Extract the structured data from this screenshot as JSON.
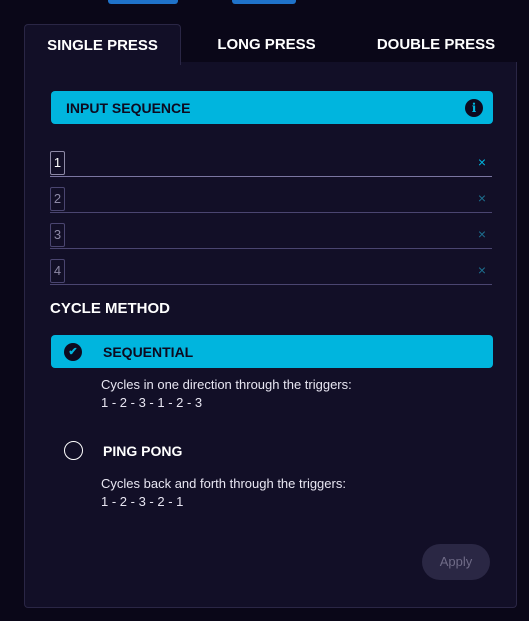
{
  "tabs": [
    {
      "label": "SINGLE PRESS",
      "active": true
    },
    {
      "label": "LONG PRESS",
      "active": false
    },
    {
      "label": "DOUBLE PRESS",
      "active": false
    }
  ],
  "input_sequence": {
    "title": "INPUT SEQUENCE",
    "info_icon": "info-icon",
    "rows": [
      {
        "number": "1",
        "value": "",
        "clear": "×"
      },
      {
        "number": "2",
        "value": "",
        "clear": "×"
      },
      {
        "number": "3",
        "value": "",
        "clear": "×"
      },
      {
        "number": "4",
        "value": "",
        "clear": "×"
      }
    ]
  },
  "cycle_method": {
    "title": "CYCLE METHOD",
    "options": [
      {
        "label": "SEQUENTIAL",
        "selected": true,
        "description_line1": "Cycles in one direction through the triggers:",
        "description_line2": "1 - 2 - 3 - 1 - 2 - 3"
      },
      {
        "label": "PING PONG",
        "selected": false,
        "description_line1": "Cycles back and forth through the triggers:",
        "description_line2": "1 - 2 - 3 - 2 - 1"
      }
    ]
  },
  "apply_label": "Apply",
  "colors": {
    "accent": "#00b5de",
    "background": "#0a0718",
    "panel": "#120f27",
    "disabled_button": "#2a2744"
  }
}
